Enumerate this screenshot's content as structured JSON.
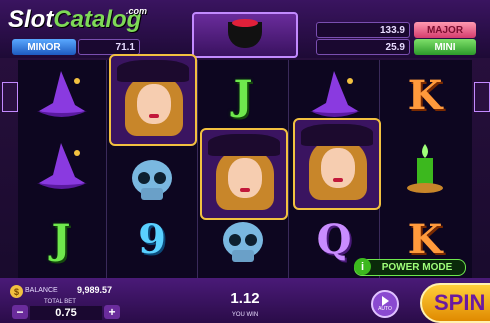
{
  "logo": {
    "slot": "Slot",
    "catalog": "Catalog",
    "com": ".com"
  },
  "jackpots": {
    "minor": {
      "label": "MINOR",
      "value": "71.1"
    },
    "major": {
      "label": "MAJOR",
      "value": "133.9"
    },
    "mini": {
      "label": "MINI",
      "value": "25.9"
    }
  },
  "reels": {
    "col1": [
      "witch-hat",
      "witch-hat",
      "J"
    ],
    "col2": [
      "witch",
      "skull",
      "9"
    ],
    "col3": [
      "J",
      "witch",
      "skull"
    ],
    "col4": [
      "witch-hat",
      "witch",
      "Q"
    ],
    "col5": [
      "K",
      "candle",
      "K"
    ]
  },
  "power_mode": {
    "icon": "i",
    "label": "POWER MODE"
  },
  "footer": {
    "coin": "$",
    "balance_label": "BALANCE",
    "balance": "9,989.57",
    "total_bet_label": "TOTAL BET",
    "total_bet": "0.75",
    "minus": "−",
    "plus": "+",
    "win": "1.12",
    "win_label": "YOU WIN",
    "auto_label": "AUTO",
    "spin_label": "SPIN"
  },
  "colors": {
    "accent": "#f2c140",
    "purple": "#6a2c9c",
    "power": "#6fe84d"
  }
}
